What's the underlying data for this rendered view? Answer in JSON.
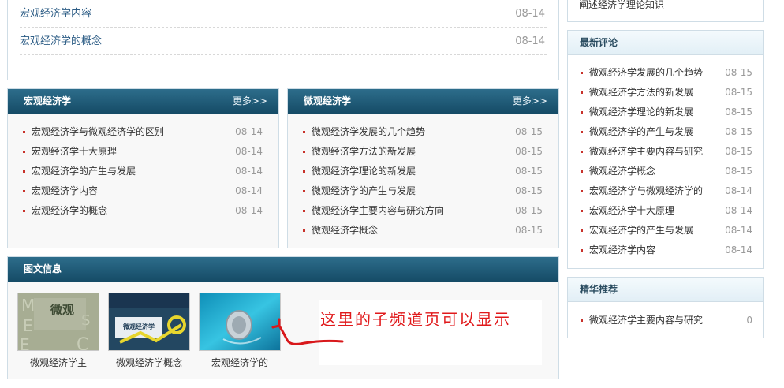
{
  "top_list": {
    "items": [
      {
        "title": "宏观经济学内容",
        "date": "08-14"
      },
      {
        "title": "宏观经济学的概念",
        "date": "08-14"
      }
    ]
  },
  "right_top": {
    "text": "阐述经济学理论知识"
  },
  "macro": {
    "title": "宏观经济学",
    "more": "更多>>",
    "items": [
      {
        "title": "宏观经济学与微观经济学的区别",
        "date": "08-14"
      },
      {
        "title": "宏观经济学十大原理",
        "date": "08-14"
      },
      {
        "title": "宏观经济学的产生与发展",
        "date": "08-14"
      },
      {
        "title": "宏观经济学内容",
        "date": "08-14"
      },
      {
        "title": "宏观经济学的概念",
        "date": "08-14"
      }
    ]
  },
  "micro": {
    "title": "微观经济学",
    "more": "更多>>",
    "items": [
      {
        "title": "微观经济学发展的几个趋势",
        "date": "08-15"
      },
      {
        "title": "微观经济学方法的新发展",
        "date": "08-15"
      },
      {
        "title": "微观经济学理论的新发展",
        "date": "08-15"
      },
      {
        "title": "微观经济学的产生与发展",
        "date": "08-15"
      },
      {
        "title": "微观经济学主要内容与研究方向",
        "date": "08-15"
      },
      {
        "title": "微观经济学概念",
        "date": "08-15"
      }
    ]
  },
  "pictures": {
    "title": "图文信息",
    "items": [
      {
        "caption": "微观经济学主",
        "cover_title": "微观"
      },
      {
        "caption": "微观经济学概念",
        "cover_title": "微观经济学"
      },
      {
        "caption": "宏观经济学的",
        "cover_title": ""
      }
    ],
    "annotation": "这里的子频道页可以显示"
  },
  "latest_comments": {
    "title": "最新评论",
    "items": [
      {
        "title": "微观经济学发展的几个趋势",
        "date": "08-15"
      },
      {
        "title": "微观经济学方法的新发展",
        "date": "08-15"
      },
      {
        "title": "微观经济学理论的新发展",
        "date": "08-15"
      },
      {
        "title": "微观经济学的产生与发展",
        "date": "08-15"
      },
      {
        "title": "微观经济学主要内容与研究",
        "date": "08-15"
      },
      {
        "title": "微观经济学概念",
        "date": "08-15"
      },
      {
        "title": "宏观经济学与微观经济学的",
        "date": "08-14"
      },
      {
        "title": "宏观经济学十大原理",
        "date": "08-14"
      },
      {
        "title": "宏观经济学的产生与发展",
        "date": "08-14"
      },
      {
        "title": "宏观经济学内容",
        "date": "08-14"
      }
    ]
  },
  "featured": {
    "title": "精华推荐",
    "items": [
      {
        "title": "微观经济学主要内容与研究",
        "count": "0"
      }
    ]
  },
  "colors": {
    "header_dark": "#1b5674",
    "link_blue": "#2c5c85",
    "bullet_red": "#c8322b",
    "annotation_red": "#e0191b"
  }
}
